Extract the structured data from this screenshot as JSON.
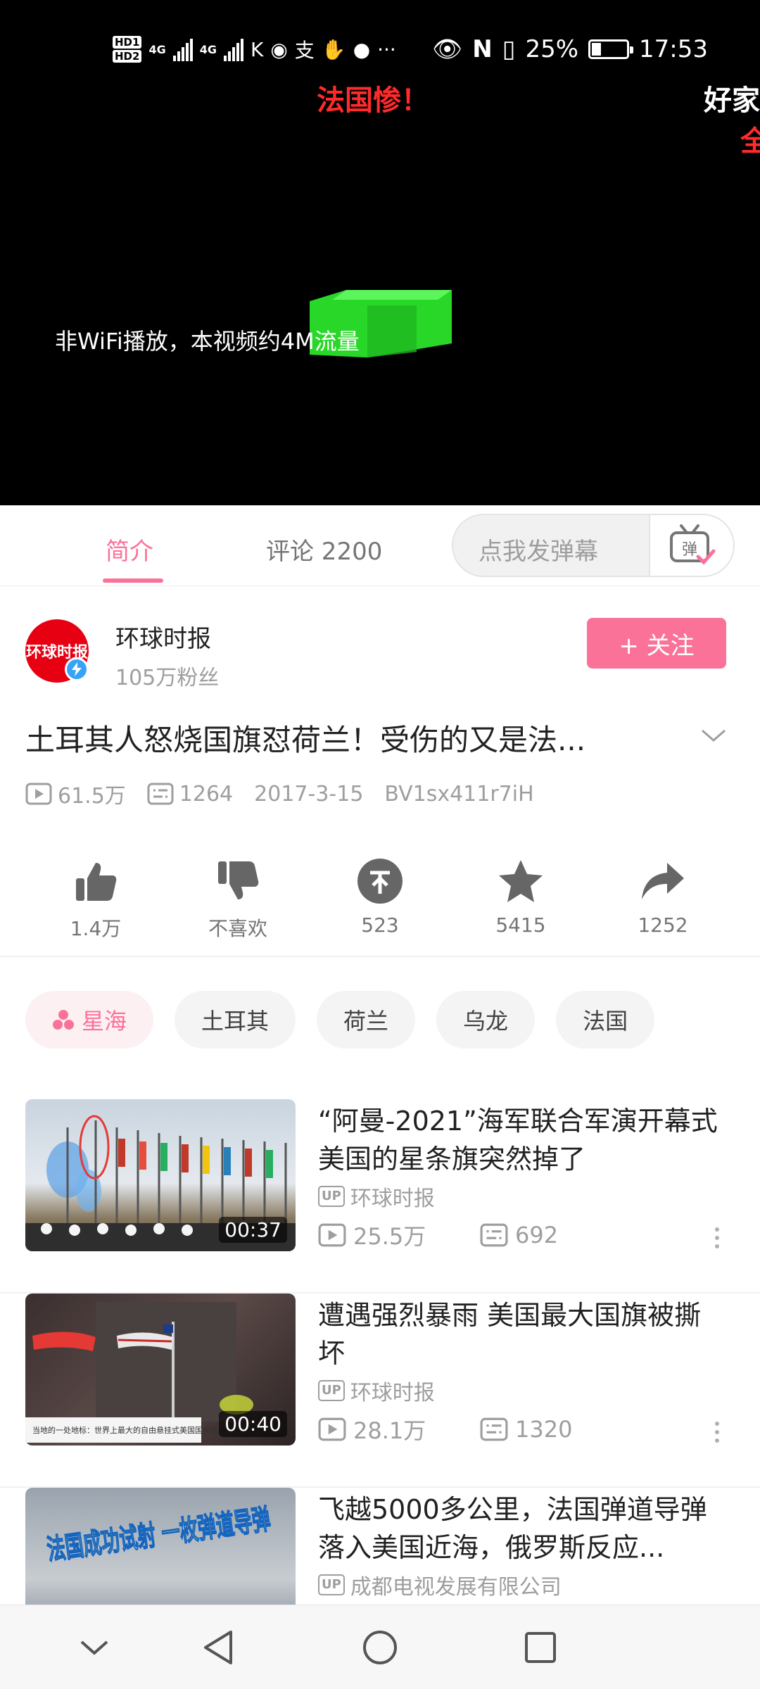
{
  "status_bar": {
    "hd1": "HD1",
    "hd2": "HD2",
    "net1": "4G",
    "net2": "4G",
    "battery_percent": "25%",
    "time": "17:53"
  },
  "video": {
    "danmaku": [
      "法国惨！",
      "好家",
      "全"
    ],
    "notice": "非WiFi播放，本视频约4M流量"
  },
  "tabs": {
    "intro": "简介",
    "comments": "评论 2200",
    "danmaku_placeholder": "点我发弹幕",
    "danmaku_button": "弹"
  },
  "uploader": {
    "name": "环球时报",
    "fans": "105万粉丝",
    "avatar_text": "环球时报",
    "follow_label": "+ 关注"
  },
  "video_info": {
    "title": "土耳其人怒烧国旗怼荷兰！受伤的又是法...",
    "views": "61.5万",
    "danmaku_count": "1264",
    "date": "2017-3-15",
    "bvid": "BV1sx411r7iH"
  },
  "actions": {
    "like": "1.4万",
    "dislike": "不喜欢",
    "coin": "523",
    "favorite": "5415",
    "share": "1252"
  },
  "tags": [
    "星海",
    "土耳其",
    "荷兰",
    "乌龙",
    "法国"
  ],
  "related": [
    {
      "title": "“阿曼-2021”海军联合军演开幕式 美国的星条旗突然掉了",
      "up_badge": "UP",
      "up": "环球时报",
      "views": "25.5万",
      "danmaku": "692",
      "duration": "00:37"
    },
    {
      "title": "遭遇强烈暴雨 美国最大国旗被撕坏",
      "up_badge": "UP",
      "up": "环球时报",
      "views": "28.1万",
      "danmaku": "1320",
      "duration": "00:40",
      "thumb_caption": "当地的一处地标：世界上最大的自由悬挂式美国国旗被撕坏。"
    },
    {
      "title": "飞越5000多公里，法国弹道导弹落入美国近海，俄罗斯反应...",
      "up_badge": "UP",
      "up": "成都电视发展有限公司",
      "thumb_text": "法国成功试射 一枚弹道导弹"
    }
  ],
  "colors": {
    "accent": "#fb7299",
    "danmaku_red": "#ff2b2b",
    "avatar_red": "#e60012",
    "verify_blue": "#36a3f7"
  }
}
